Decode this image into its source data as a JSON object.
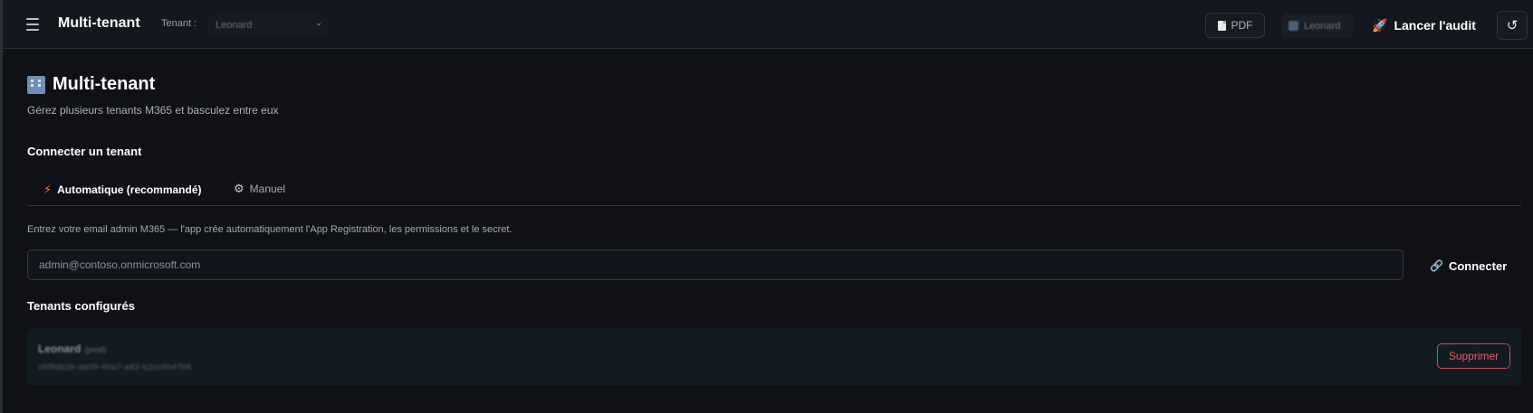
{
  "header": {
    "app_title": "Multi-tenant",
    "tenant_label": "Tenant :",
    "tenant_selected": "Leonard",
    "pdf_label": "PDF",
    "user_name": "Leonard",
    "audit_label": "Lancer l'audit",
    "refresh_symbol": "↺"
  },
  "page": {
    "title": "Multi-tenant",
    "subtitle": "Gérez plusieurs tenants M365 et basculez entre eux"
  },
  "connect": {
    "section_title": "Connecter un tenant",
    "tabs": [
      {
        "label": "Automatique (recommandé)",
        "icon": "bolt-icon",
        "active": true
      },
      {
        "label": "Manuel",
        "icon": "gear-icon",
        "active": false
      }
    ],
    "help_text": "Entrez votre email admin M365 — l'app crée automatiquement l'App Registration, les permissions et le secret.",
    "email_placeholder": "admin@contoso.onmicrosoft.com",
    "email_value": "",
    "connect_label": "Connecter"
  },
  "tenants": {
    "section_title": "Tenants configurés",
    "items": [
      {
        "name": "Leonard",
        "tag": "(prod)",
        "id": "c6f8db2b-ab09-40a7-a83-b2cc6b47b6",
        "delete_label": "Supprimer"
      }
    ]
  },
  "colors": {
    "background": "#0f1116",
    "topbar": "#14171d",
    "danger": "#ef5b66",
    "bolt": "#ff7a3a"
  }
}
